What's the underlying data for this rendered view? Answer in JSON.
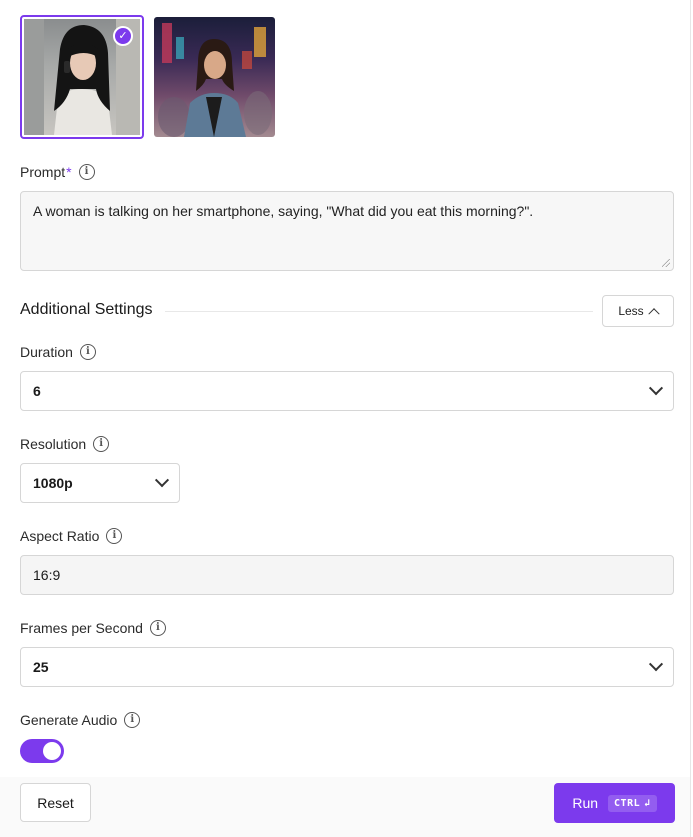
{
  "thumbnails": [
    {
      "icon": "woman-phone-thumbnail",
      "selected": true
    },
    {
      "icon": "woman-city-thumbnail",
      "selected": false
    }
  ],
  "prompt": {
    "label": "Prompt",
    "required_mark": "*",
    "value": "A woman is talking on her smartphone, saying, \"What did you eat this morning?\"."
  },
  "additional_settings": {
    "title": "Additional Settings",
    "toggle_label": "Less"
  },
  "duration": {
    "label": "Duration",
    "value": "6"
  },
  "resolution": {
    "label": "Resolution",
    "value": "1080p"
  },
  "aspect_ratio": {
    "label": "Aspect Ratio",
    "value": "16:9"
  },
  "fps": {
    "label": "Frames per Second",
    "value": "25"
  },
  "generate_audio": {
    "label": "Generate Audio",
    "enabled": true
  },
  "actions": {
    "reset_label": "Reset",
    "run_label": "Run",
    "run_shortcut": "CTRL"
  },
  "colors": {
    "accent": "#7c3aed"
  }
}
